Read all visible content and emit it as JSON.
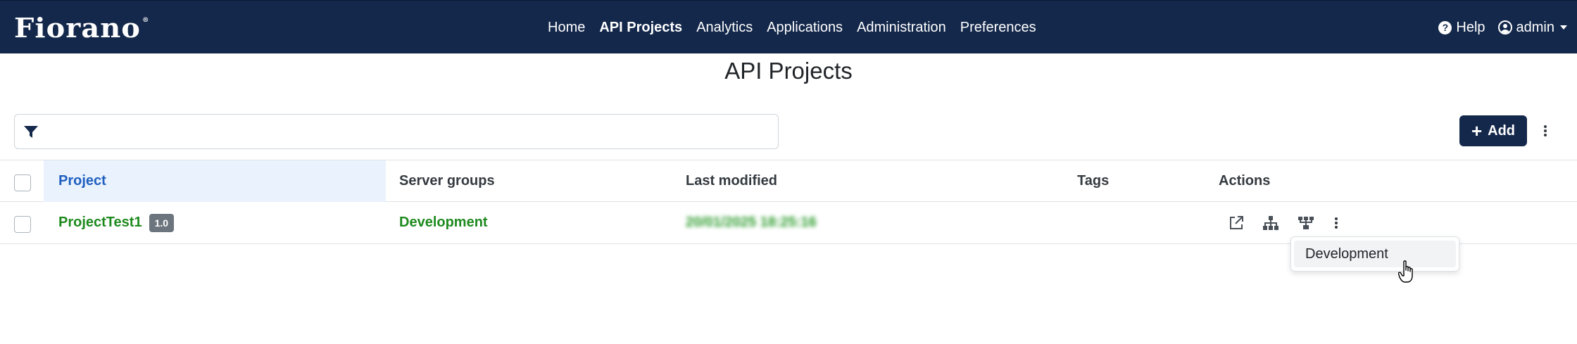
{
  "app": {
    "logo_text": "Fiorano",
    "logo_mark": "®"
  },
  "nav": {
    "links": [
      {
        "label": "Home",
        "active": false
      },
      {
        "label": "API Projects",
        "active": true
      },
      {
        "label": "Analytics",
        "active": false
      },
      {
        "label": "Applications",
        "active": false
      },
      {
        "label": "Administration",
        "active": false
      },
      {
        "label": "Preferences",
        "active": false
      }
    ],
    "help_label": "Help",
    "user_label": "admin"
  },
  "page": {
    "title": "API Projects"
  },
  "filter": {
    "placeholder": "",
    "value": "",
    "icon": "filter-icon"
  },
  "toolbar": {
    "add_label": "Add"
  },
  "table": {
    "headers": {
      "project": "Project",
      "server_groups": "Server groups",
      "last_modified": "Last modified",
      "tags": "Tags",
      "actions": "Actions"
    },
    "sorted_column": "project",
    "rows": [
      {
        "project": "ProjectTest1",
        "version": "1.0",
        "server_groups": "Development",
        "last_modified": "20/01/2025 18:25:16",
        "tags": ""
      }
    ]
  },
  "actions_dropdown": {
    "items": [
      "Development"
    ]
  },
  "colors": {
    "navbar": "#14284b",
    "accent_green": "#1e8a1e",
    "sorted_header": "#1f5fbf",
    "badge": "#6c757d"
  }
}
